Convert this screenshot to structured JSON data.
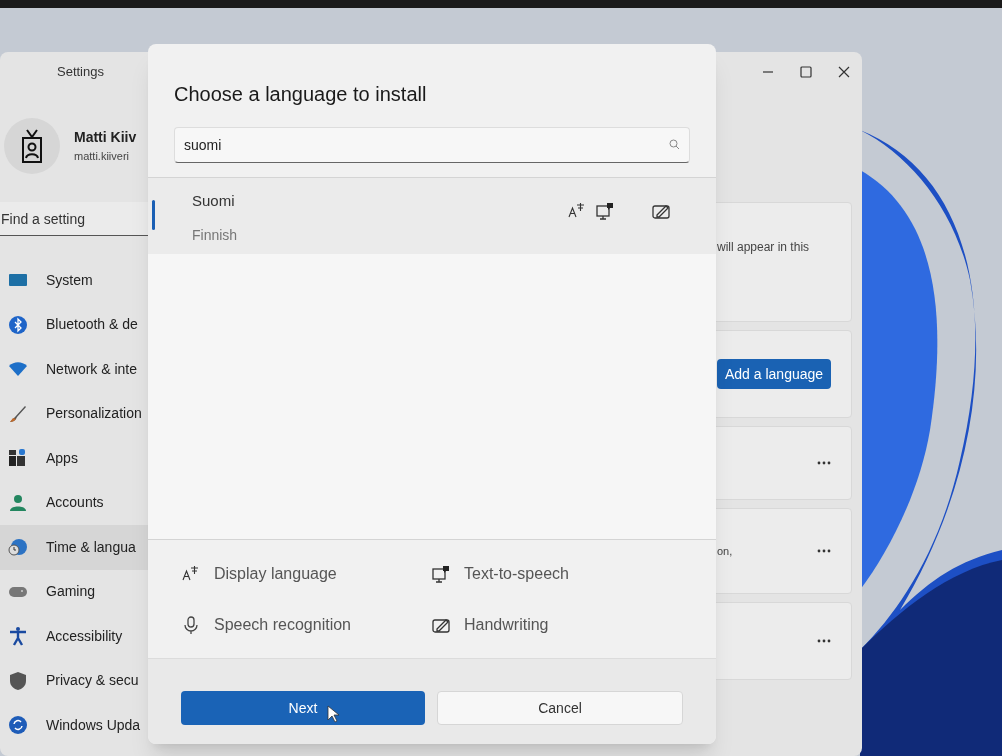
{
  "window": {
    "title": "Settings"
  },
  "account": {
    "name": "Matti Kiiv",
    "email": "matti.kiiveri"
  },
  "search": {
    "placeholder": "Find a setting"
  },
  "sidebar": {
    "items": [
      {
        "label": "System",
        "selected": false
      },
      {
        "label": "Bluetooth & de",
        "selected": false
      },
      {
        "label": "Network & inte",
        "selected": false
      },
      {
        "label": "Personalization",
        "selected": false
      },
      {
        "label": "Apps",
        "selected": false
      },
      {
        "label": "Accounts",
        "selected": false
      },
      {
        "label": "Time & langua",
        "selected": true
      },
      {
        "label": "Gaming",
        "selected": false
      },
      {
        "label": "Accessibility",
        "selected": false
      },
      {
        "label": "Privacy & secu",
        "selected": false
      },
      {
        "label": "Windows Upda",
        "selected": false
      }
    ]
  },
  "cards": [
    {
      "kind": "text",
      "text": "will appear in this"
    },
    {
      "kind": "button",
      "label": "Add a language"
    },
    {
      "kind": "menu"
    },
    {
      "kind": "menu",
      "text": "on,"
    },
    {
      "kind": "menu"
    }
  ],
  "dialog": {
    "title": "Choose a language to install",
    "search": {
      "value": "suomi"
    },
    "results": [
      {
        "name": "Suomi",
        "english_name": "Finnish",
        "selected": true,
        "features": {
          "display_language": true,
          "text_to_speech": true,
          "speech_recognition": false,
          "handwriting": true
        }
      }
    ],
    "legend": [
      {
        "kind": "display_language",
        "label": "Display language"
      },
      {
        "kind": "text_to_speech",
        "label": "Text-to-speech"
      },
      {
        "kind": "speech_recognition",
        "label": "Speech recognition"
      },
      {
        "kind": "handwriting",
        "label": "Handwriting"
      }
    ],
    "buttons": [
      {
        "kind": "primary",
        "label": "Next"
      },
      {
        "kind": "secondary",
        "label": "Cancel"
      }
    ]
  }
}
